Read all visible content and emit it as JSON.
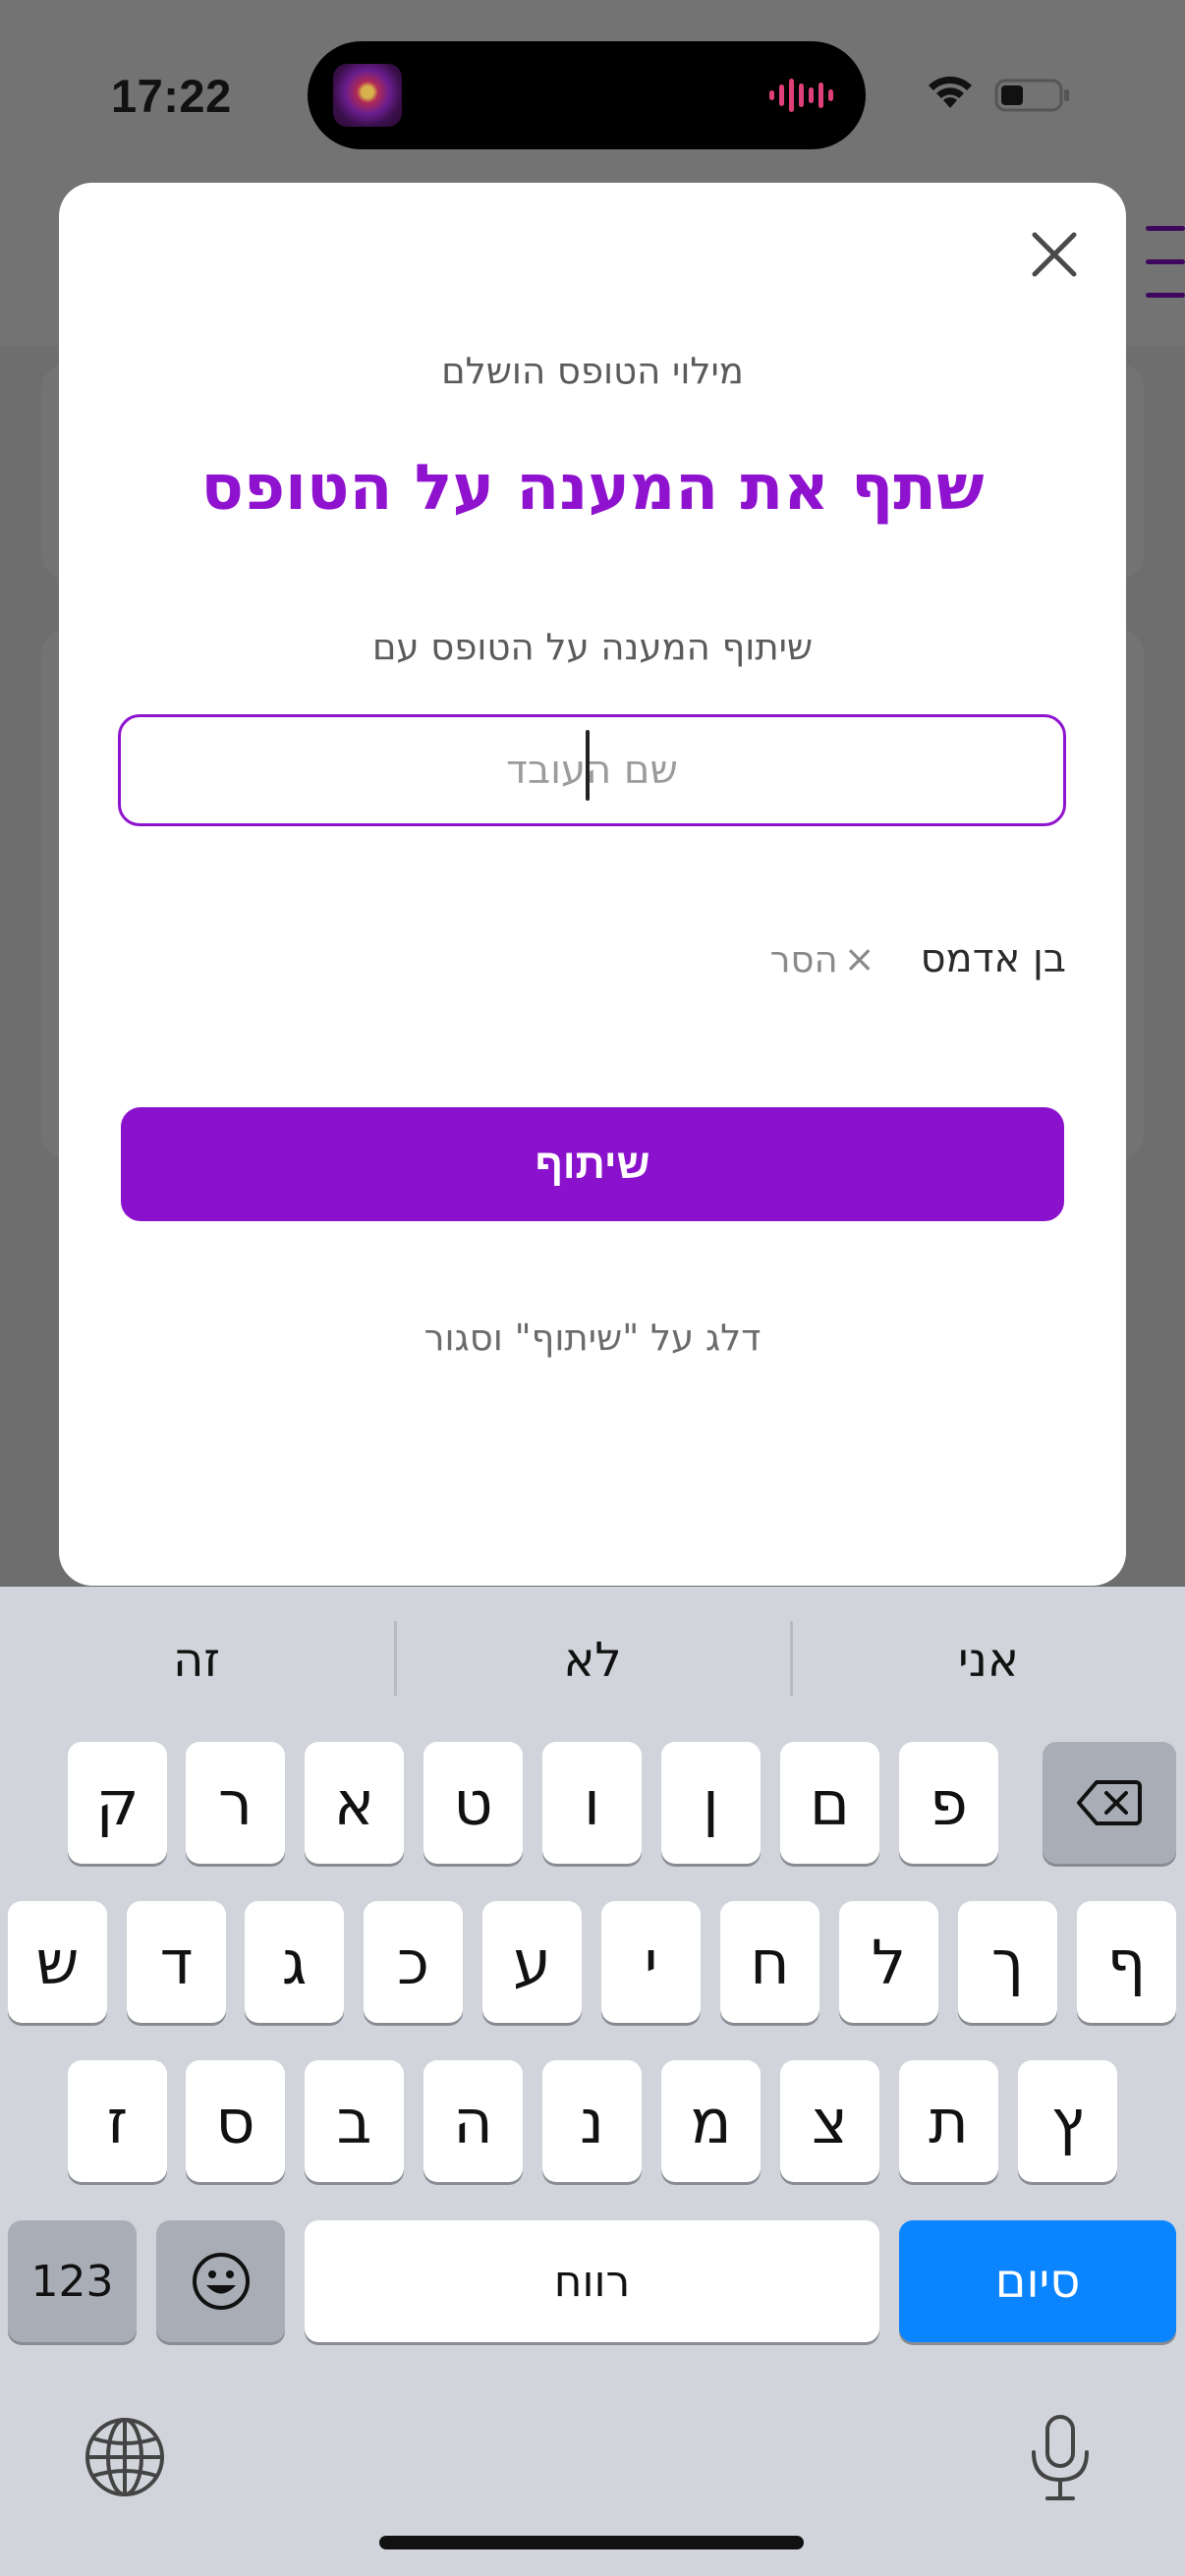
{
  "status_bar": {
    "time": "17:22"
  },
  "modal": {
    "close_icon": "close-icon",
    "subtitle": "מילוי הטופס הושלם",
    "title": "שתף את המענה על הטופס",
    "share_with_label": "שיתוף המענה על הטופס עם",
    "name_input": {
      "placeholder": "שם העובד",
      "value": ""
    },
    "selected_recipient": {
      "name": "בן אדמס",
      "remove_label": "הסר"
    },
    "share_button_label": "שיתוף",
    "hint": "דלג על \"שיתוף\" וסגור"
  },
  "keyboard": {
    "suggestions": [
      "זה",
      "לא",
      "אני"
    ],
    "row1": [
      "ק",
      "ר",
      "א",
      "ט",
      "ו",
      "ן",
      "ם",
      "פ"
    ],
    "row2": [
      "ש",
      "ד",
      "ג",
      "כ",
      "ע",
      "י",
      "ח",
      "ל",
      "ך",
      "ף"
    ],
    "row3": [
      "ז",
      "ס",
      "ב",
      "ה",
      "נ",
      "מ",
      "צ",
      "ת",
      "ץ"
    ],
    "numbers_key": "123",
    "space_key": "רווח",
    "done_key": "סיום"
  },
  "colors": {
    "accent": "#8b12cc",
    "keyboard_bg": "#d1d4da",
    "done_key": "#0a84ff"
  }
}
